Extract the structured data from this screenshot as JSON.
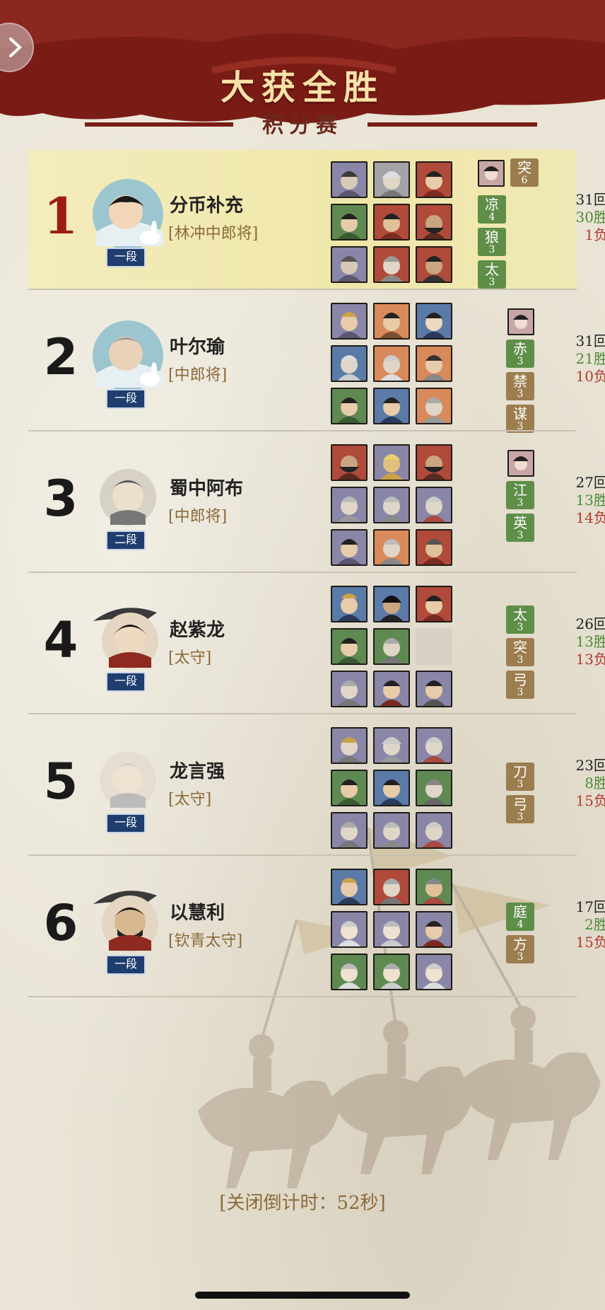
{
  "header": {
    "title": "大获全胜",
    "subtitle": "积分赛",
    "back_icon": "chevron-right-icon",
    "banner_color": "#7a1c16"
  },
  "rows": [
    {
      "rank": "1",
      "name": "分币补充",
      "title": "[林冲中郎将]",
      "dan": "一段",
      "tags": [
        {
          "char": "突",
          "num": "6",
          "color": "brown"
        },
        {
          "char": "凉",
          "num": "4",
          "color": "green"
        },
        {
          "char": "狼",
          "num": "3",
          "color": "green"
        },
        {
          "char": "太",
          "num": "3",
          "color": "green"
        }
      ],
      "rounds": "31回",
      "wins": "30胜",
      "losses": "1负",
      "highlight": true
    },
    {
      "rank": "2",
      "name": "叶尔瑜",
      "title": "[中郎将]",
      "dan": "一段",
      "tags": [
        {
          "char": "赤",
          "num": "3",
          "color": "green"
        },
        {
          "char": "禁",
          "num": "3",
          "color": "brown"
        },
        {
          "char": "谋",
          "num": "3",
          "color": "brown"
        }
      ],
      "rounds": "31回",
      "wins": "21胜",
      "losses": "10负"
    },
    {
      "rank": "3",
      "name": "蜀中阿布",
      "title": "[中郎将]",
      "dan": "二段",
      "tags": [
        {
          "char": "江",
          "num": "3",
          "color": "green"
        },
        {
          "char": "英",
          "num": "3",
          "color": "green"
        }
      ],
      "rounds": "27回",
      "wins": "13胜",
      "losses": "14负"
    },
    {
      "rank": "4",
      "name": "赵紫龙",
      "title": "[太守]",
      "dan": "一段",
      "tags": [
        {
          "char": "太",
          "num": "3",
          "color": "green"
        },
        {
          "char": "突",
          "num": "3",
          "color": "brown"
        },
        {
          "char": "弓",
          "num": "3",
          "color": "brown"
        }
      ],
      "rounds": "26回",
      "wins": "13胜",
      "losses": "13负"
    },
    {
      "rank": "5",
      "name": "龙言强",
      "title": "[太守]",
      "dan": "一段",
      "tags": [
        {
          "char": "刀",
          "num": "3",
          "color": "brown"
        },
        {
          "char": "弓",
          "num": "3",
          "color": "brown"
        }
      ],
      "rounds": "23回",
      "wins": "8胜",
      "losses": "15负"
    },
    {
      "rank": "6",
      "name": "以慧利",
      "title": "[钦青太守]",
      "dan": "一段",
      "tags": [
        {
          "char": "庭",
          "num": "4",
          "color": "green"
        },
        {
          "char": "方",
          "num": "3",
          "color": "brown"
        }
      ],
      "rounds": "17回",
      "wins": "2胜",
      "losses": "15负"
    }
  ],
  "countdown": "[关闭倒计时：52秒]",
  "colors": {
    "rank_one": "#9c1c14",
    "wins": "#4f8a3a",
    "losses": "#b43a30",
    "title_text": "#8c6a3a"
  }
}
